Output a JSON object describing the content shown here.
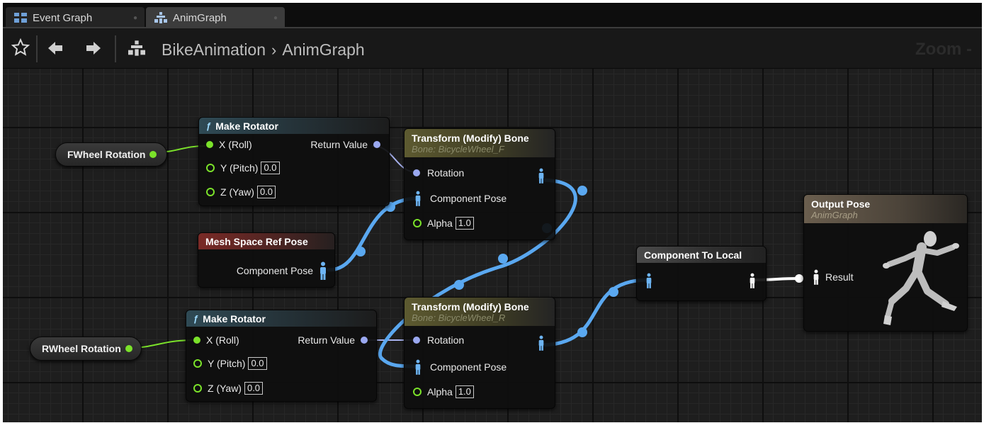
{
  "tabs": [
    {
      "label": "Event Graph",
      "icon": "event-graph-icon"
    },
    {
      "label": "AnimGraph",
      "icon": "anim-graph-icon"
    }
  ],
  "breadcrumb": {
    "asset": "BikeAnimation",
    "separator": "›",
    "graph": "AnimGraph"
  },
  "zoom_label": "Zoom -",
  "variables": {
    "front": "FWheel Rotation",
    "rear": "RWheel Rotation"
  },
  "make_rotator_1": {
    "title": "Make Rotator",
    "x_label": "X (Roll)",
    "y_label": "Y (Pitch)",
    "y_value": "0.0",
    "z_label": "Z (Yaw)",
    "z_value": "0.0",
    "return_label": "Return Value"
  },
  "make_rotator_2": {
    "title": "Make Rotator",
    "x_label": "X (Roll)",
    "y_label": "Y (Pitch)",
    "y_value": "0.0",
    "z_label": "Z (Yaw)",
    "z_value": "0.0",
    "return_label": "Return Value"
  },
  "mesh_ref": {
    "title": "Mesh Space Ref Pose",
    "pin": "Component Pose"
  },
  "transform_f": {
    "title": "Transform (Modify) Bone",
    "subtitle": "Bone: BicycleWheel_F",
    "rotation": "Rotation",
    "pose": "Component Pose",
    "alpha": "Alpha",
    "alpha_value": "1.0"
  },
  "transform_r": {
    "title": "Transform (Modify) Bone",
    "subtitle": "Bone: BicycleWheel_R",
    "rotation": "Rotation",
    "pose": "Component Pose",
    "alpha": "Alpha",
    "alpha_value": "1.0"
  },
  "comp_to_local": {
    "title": "Component To Local"
  },
  "output_pose": {
    "title": "Output Pose",
    "subtitle": "AnimGraph",
    "result": "Result"
  },
  "colors": {
    "exec_green": "#7be22a",
    "rotator_purple": "#9aa8f0",
    "pose_wire": "#5aa8f0",
    "local_wire": "#ffffff"
  }
}
